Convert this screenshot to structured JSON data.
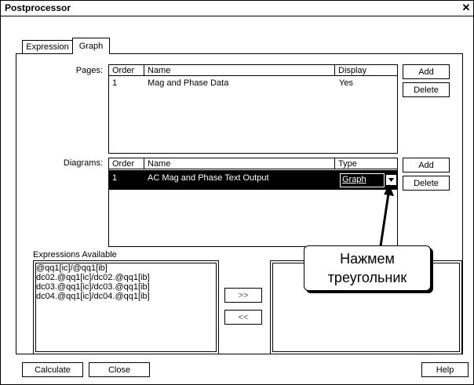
{
  "window": {
    "title": "Postprocessor",
    "close_label": "✕"
  },
  "tabs": [
    {
      "label": "Expression",
      "active": false
    },
    {
      "label": "Graph",
      "active": true
    }
  ],
  "pages": {
    "label": "Pages:",
    "columns": [
      "Order",
      "Name",
      "Display"
    ],
    "rows": [
      {
        "order": "1",
        "name": "Mag and Phase Data",
        "display": "Yes"
      }
    ],
    "add_label": "Add",
    "delete_label": "Delete"
  },
  "diagrams": {
    "label": "Diagrams:",
    "columns": [
      "Order",
      "Name",
      "Type"
    ],
    "rows": [
      {
        "order": "1",
        "name": "AC Mag and Phase Text Output",
        "type": "Graph"
      }
    ],
    "add_label": "Add",
    "delete_label": "Delete"
  },
  "expressions": {
    "label": "Expressions Available",
    "items": [
      "@qq1[ic]/@qq1[ib]",
      "dc02.@qq1[ic]/dc02.@qq1[ib]",
      "dc03.@qq1[ic]/dc03.@qq1[ib]",
      "dc04.@qq1[ic]/dc04.@qq1[ib]"
    ],
    "move_right_label": ">>",
    "move_left_label": "<<"
  },
  "callout": {
    "line1": "Нажмем",
    "line2": "треугольник"
  },
  "footer": {
    "calculate_label": "Calculate",
    "close_label": "Close",
    "help_label": "Help"
  }
}
